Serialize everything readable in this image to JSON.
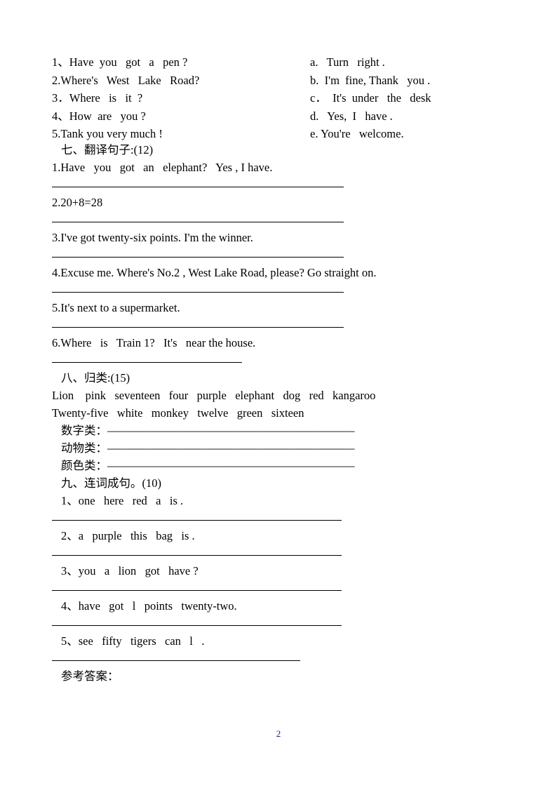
{
  "document": {
    "page_number": "2"
  },
  "matching": {
    "left": [
      "1、Have  you   got   a   pen ?",
      "2.Where's   West   Lake   Road?",
      "3．Where   is   it  ?",
      "4、How  are   you ?",
      "5.Tank you very much !"
    ],
    "right": [
      "a.   Turn   right .",
      "b.  I'm  fine, Thank   you .",
      "c．  It's  under   the   desk",
      "d.   Yes,  I   have .",
      "e. You're   welcome."
    ]
  },
  "section_seven": {
    "heading": "七、翻译句子:(12)",
    "items": [
      "1.Have   you   got   an   elephant?   Yes , I have.",
      "2.20+8=28",
      "3.I've got twenty-six points. I'm the winner.",
      "4.Excuse me. Where's No.2 , West Lake Road, please? Go straight on.",
      "5.It's next to a supermarket.",
      "6.Where   is   Train 1?   It's   near the house."
    ]
  },
  "section_eight": {
    "heading": "八、归类:(15)",
    "word_bank": [
      "Lion    pink   seventeen   four   purple   elephant   dog   red   kangaroo",
      "Twenty-five   white   monkey   twelve   green   sixteen"
    ],
    "categories": [
      {
        "label": "数字类：",
        "dashes": "——————————————————————"
      },
      {
        "label": "动物类：",
        "dashes": "——————————————————————"
      },
      {
        "label": "颜色类：",
        "dashes": "——————————————————————"
      }
    ]
  },
  "section_nine": {
    "heading": "九、连词成句。(10)",
    "items": [
      "1、one   here   red   a   is .",
      "2、a   purple   this   bag   is .",
      "3、you   a   lion   got   have ?",
      "4、have   got   l   points   twenty-two.",
      "5、see   fifty   tigers   can   l   ."
    ]
  },
  "answers_label": "参考答案："
}
